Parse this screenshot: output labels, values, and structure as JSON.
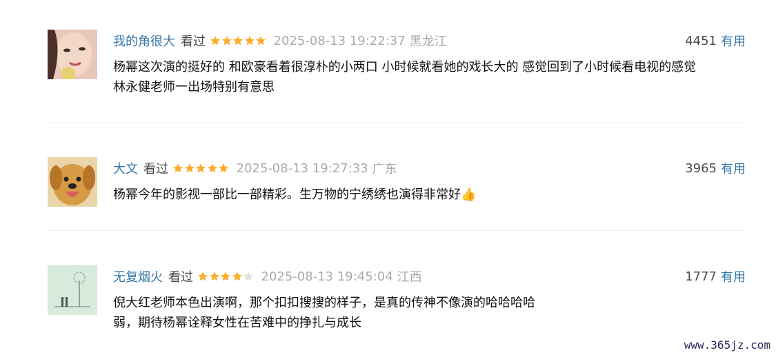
{
  "reviews": [
    {
      "author": "我的角很大",
      "status": "看过",
      "rating": 5,
      "time": "2025-08-13 19:22:37",
      "region": "黑龙江",
      "votes": "4451",
      "useful_label": "有用",
      "content_lines": [
        "杨幂这次演的挺好的 和欧豪看着很淳朴的小两口 小时候就看她的戏长大的 感觉回到了小时候看电视的感觉",
        "林永健老师一出场特别有意思"
      ]
    },
    {
      "author": "大文",
      "status": "看过",
      "rating": 5,
      "time": "2025-08-13 19:27:33",
      "region": "广东",
      "votes": "3965",
      "useful_label": "有用",
      "content_lines": [
        "杨幂今年的影视一部比一部精彩。生万物的宁绣绣也演得非常好👍"
      ]
    },
    {
      "author": "无复烟火",
      "status": "看过",
      "rating": 4,
      "time": "2025-08-13 19:45:04",
      "region": "江西",
      "votes": "1777",
      "useful_label": "有用",
      "content_lines": [
        "倪大红老师本色出演啊，那个扣扣搜搜的样子，是真的传神不像演的哈哈哈哈",
        "弱，期待杨幂诠释女性在苦难中的挣扎与成长"
      ]
    }
  ],
  "watermark": "www.365jz.com",
  "colors": {
    "link": "#3377aa",
    "star_on": "#ffac2d",
    "star_off": "#e0e0e0",
    "muted": "#aaaaaa"
  }
}
